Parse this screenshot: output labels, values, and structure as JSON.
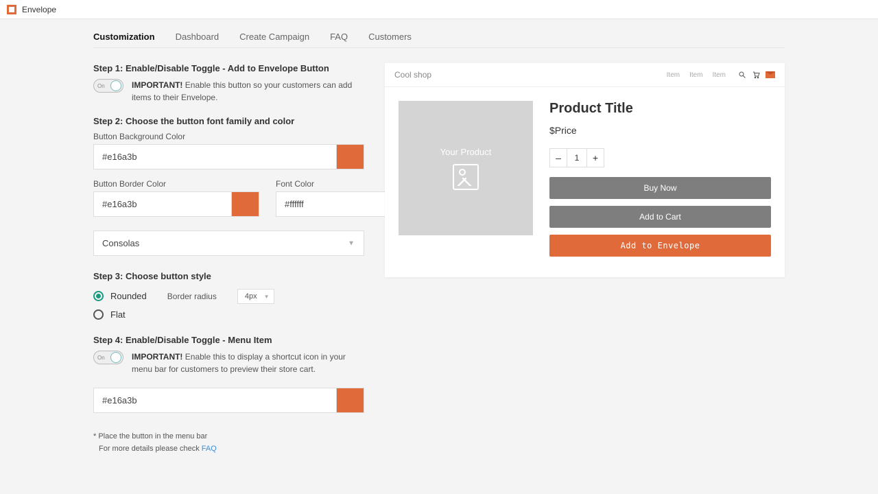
{
  "app": {
    "title": "Envelope"
  },
  "tabs": [
    "Customization",
    "Dashboard",
    "Create Campaign",
    "FAQ",
    "Customers"
  ],
  "step1": {
    "title": "Step 1: Enable/Disable Toggle - Add to Envelope Button",
    "toggle_label": "On",
    "imp_label": "IMPORTANT!",
    "imp_text": "Enable this button so your customers can add items to their Envelope."
  },
  "step2": {
    "title": "Step 2: Choose the button font family and color",
    "bg_label": "Button Background Color",
    "bg_value": "#e16a3b",
    "border_label": "Button Border Color",
    "border_value": "#e16a3b",
    "font_label": "Font Color",
    "font_value": "#ffffff",
    "font_family": "Consolas"
  },
  "step3": {
    "title": "Step 3: Choose button style",
    "rounded": "Rounded",
    "flat": "Flat",
    "radius_label": "Border radius",
    "radius_value": "4px"
  },
  "step4": {
    "title": "Step 4: Enable/Disable Toggle - Menu Item",
    "toggle_label": "On",
    "imp_label": "IMPORTANT!",
    "imp_text": "Enable this to display a shortcut icon in your menu bar for customers to preview their store cart.",
    "color_value": "#e16a3b"
  },
  "note": {
    "line1": "*  Place the button in the menu bar",
    "line2": "For more details please check ",
    "faq": "FAQ"
  },
  "preview": {
    "shop": "Cool shop",
    "menu": [
      "Item",
      "Item",
      "Item"
    ],
    "img_text": "Your Product",
    "title": "Product Title",
    "price": "$Price",
    "qty": "1",
    "minus": "–",
    "plus": "+",
    "buy": "Buy Now",
    "cart": "Add to Cart",
    "env": "Add to Envelope"
  },
  "colors": {
    "accent": "#e16a3b"
  }
}
